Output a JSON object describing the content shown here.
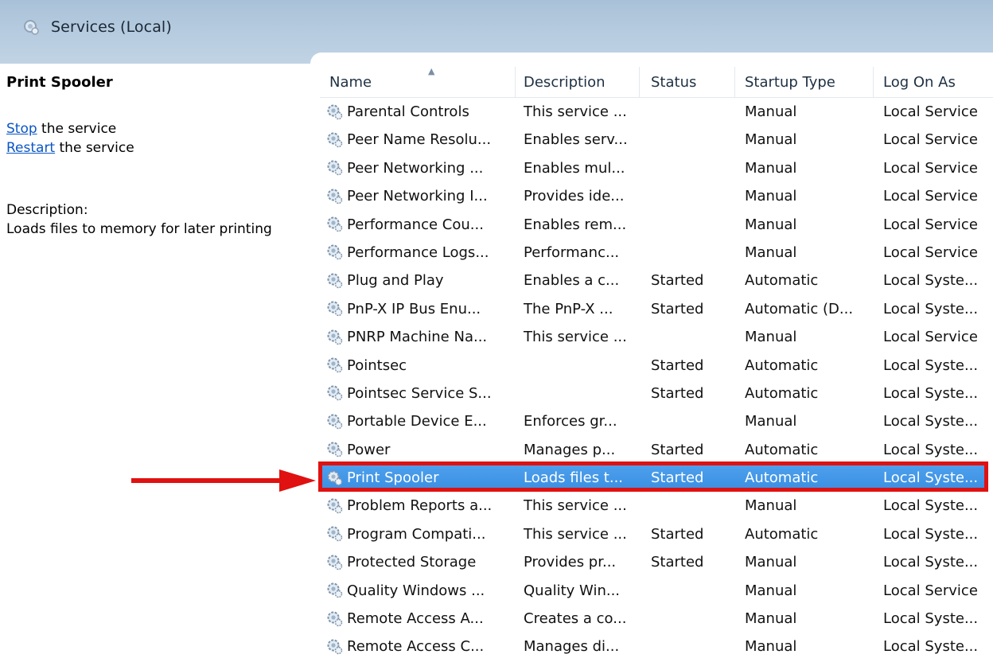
{
  "header": {
    "title": "Services (Local)",
    "icon": "services-gear-icon"
  },
  "details": {
    "service_name": "Print Spooler",
    "stop_link": "Stop",
    "stop_suffix": " the service",
    "restart_link": "Restart",
    "restart_suffix": " the service",
    "description_label": "Description:",
    "description_text": "Loads files to memory for later printing"
  },
  "table": {
    "columns": [
      "Name",
      "Description",
      "Status",
      "Startup Type",
      "Log On As"
    ],
    "sort_indicator": "▲",
    "rows": [
      {
        "name": "Parental Controls",
        "description": "This service ...",
        "status": "",
        "startup": "Manual",
        "logon": "Local Service"
      },
      {
        "name": "Peer Name Resolu...",
        "description": "Enables serv...",
        "status": "",
        "startup": "Manual",
        "logon": "Local Service"
      },
      {
        "name": "Peer Networking ...",
        "description": "Enables mul...",
        "status": "",
        "startup": "Manual",
        "logon": "Local Service"
      },
      {
        "name": "Peer Networking I...",
        "description": "Provides ide...",
        "status": "",
        "startup": "Manual",
        "logon": "Local Service"
      },
      {
        "name": "Performance Cou...",
        "description": "Enables rem...",
        "status": "",
        "startup": "Manual",
        "logon": "Local Service"
      },
      {
        "name": "Performance Logs...",
        "description": "Performanc...",
        "status": "",
        "startup": "Manual",
        "logon": "Local Service"
      },
      {
        "name": "Plug and Play",
        "description": "Enables a c...",
        "status": "Started",
        "startup": "Automatic",
        "logon": "Local Syste..."
      },
      {
        "name": "PnP-X IP Bus Enu...",
        "description": "The PnP-X ...",
        "status": "Started",
        "startup": "Automatic (D...",
        "logon": "Local Syste..."
      },
      {
        "name": "PNRP Machine Na...",
        "description": "This service ...",
        "status": "",
        "startup": "Manual",
        "logon": "Local Service"
      },
      {
        "name": "Pointsec",
        "description": "",
        "status": "Started",
        "startup": "Automatic",
        "logon": "Local Syste..."
      },
      {
        "name": "Pointsec Service S...",
        "description": "",
        "status": "Started",
        "startup": "Automatic",
        "logon": "Local Syste..."
      },
      {
        "name": "Portable Device E...",
        "description": "Enforces gr...",
        "status": "",
        "startup": "Manual",
        "logon": "Local Syste..."
      },
      {
        "name": "Power",
        "description": "Manages p...",
        "status": "Started",
        "startup": "Automatic",
        "logon": "Local Syste..."
      },
      {
        "name": "Print Spooler",
        "description": "Loads files t...",
        "status": "Started",
        "startup": "Automatic",
        "logon": "Local Syste...",
        "selected": true
      },
      {
        "name": "Problem Reports a...",
        "description": "This service ...",
        "status": "",
        "startup": "Manual",
        "logon": "Local Syste..."
      },
      {
        "name": "Program Compati...",
        "description": "This service ...",
        "status": "Started",
        "startup": "Automatic",
        "logon": "Local Syste..."
      },
      {
        "name": "Protected Storage",
        "description": "Provides pr...",
        "status": "Started",
        "startup": "Manual",
        "logon": "Local Syste..."
      },
      {
        "name": "Quality Windows ...",
        "description": "Quality Win...",
        "status": "",
        "startup": "Manual",
        "logon": "Local Service"
      },
      {
        "name": "Remote Access A...",
        "description": "Creates a co...",
        "status": "",
        "startup": "Manual",
        "logon": "Local Syste..."
      },
      {
        "name": "Remote Access C...",
        "description": "Manages di...",
        "status": "",
        "startup": "Manual",
        "logon": "Local Syste..."
      }
    ]
  },
  "colors": {
    "selection": "#3a8fe3",
    "highlight_outline": "#e01111",
    "arrow": "#e01111",
    "link": "#0b56c5"
  }
}
